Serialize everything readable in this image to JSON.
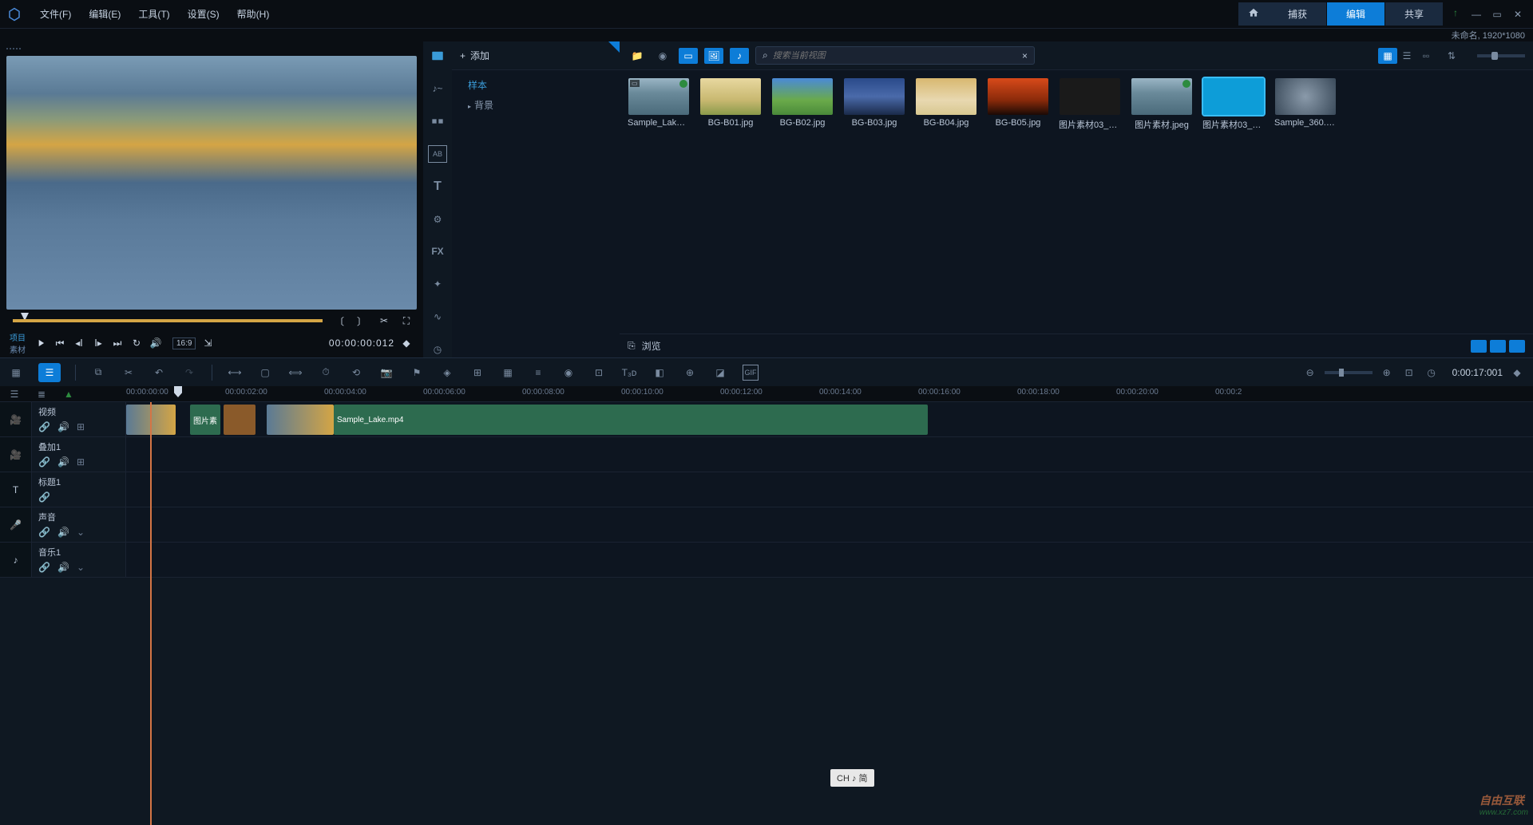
{
  "titlebar": {
    "menu": [
      "文件(F)",
      "编辑(E)",
      "工具(T)",
      "设置(S)",
      "帮助(H)"
    ],
    "tabs": {
      "capture": "捕获",
      "edit": "编辑",
      "share": "共享"
    },
    "status": "未命名, 1920*1080"
  },
  "preview": {
    "mode_project": "项目",
    "mode_clip": "素材",
    "aspect": "16:9",
    "timecode": "00:00:00:012"
  },
  "library": {
    "add": "添加",
    "tree": {
      "sample": "样本",
      "background": "背景"
    },
    "search_placeholder": "搜索当前视图",
    "browse": "浏览",
    "items": [
      {
        "label": "Sample_Lake....",
        "cls": "th-lake",
        "badge": true,
        "fmt": true
      },
      {
        "label": "BG-B01.jpg",
        "cls": "th-b01"
      },
      {
        "label": "BG-B02.jpg",
        "cls": "th-b02"
      },
      {
        "label": "BG-B03.jpg",
        "cls": "th-b03"
      },
      {
        "label": "BG-B04.jpg",
        "cls": "th-b04"
      },
      {
        "label": "BG-B05.jpg",
        "cls": "th-b05"
      },
      {
        "label": "图片素材03_副...",
        "cls": "th-dark"
      },
      {
        "label": "图片素材.jpeg",
        "cls": "th-lake",
        "badge": true
      },
      {
        "label": "图片素材03_副...",
        "cls": "th-blue",
        "selected": true
      },
      {
        "label": "Sample_360.m...",
        "cls": "th-360"
      }
    ]
  },
  "timeline": {
    "toolbar_time": "0:00:17:001",
    "ruler": [
      "00:00:00:00",
      "00:00:02:00",
      "00:00:04:00",
      "00:00:06:00",
      "00:00:08:00",
      "00:00:10:00",
      "00:00:12:00",
      "00:00:14:00",
      "00:00:16:00",
      "00:00:18:00",
      "00:00:20:00",
      "00:00:2"
    ],
    "tracks": {
      "video": "视频",
      "overlay": "叠加1",
      "title": "标题1",
      "voice": "声音",
      "music": "音乐1"
    },
    "clips": {
      "clip2_label": "图片素",
      "clip4_label": "Sample_Lake.mp4"
    }
  },
  "ime": "CH ♪ 简",
  "watermark": {
    "brand": "自由互联",
    "url": "www.xz7.com"
  }
}
